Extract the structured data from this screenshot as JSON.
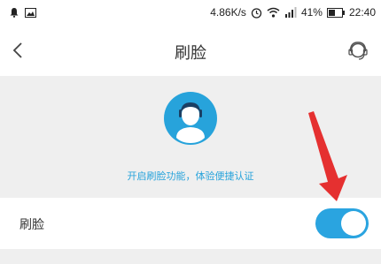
{
  "status_bar": {
    "speed": "4.86K/s",
    "battery_percent": "41%",
    "time": "22:40",
    "icons": [
      "notification-icon",
      "image-icon",
      "alarm-icon",
      "wifi-icon",
      "signal-icon",
      "battery-icon"
    ]
  },
  "header": {
    "title": "刷脸",
    "back_icon": "chevron-left-icon",
    "service_icon": "customer-service-icon"
  },
  "hero": {
    "avatar_icon": "face-avatar-icon",
    "description": "开启刷脸功能，体验便捷认证"
  },
  "settings": {
    "face_toggle_label": "刷脸",
    "face_toggle_enabled": true
  },
  "colors": {
    "accent": "#27a3db",
    "toggle_on": "#2aa4e0",
    "arrow": "#e53030"
  }
}
